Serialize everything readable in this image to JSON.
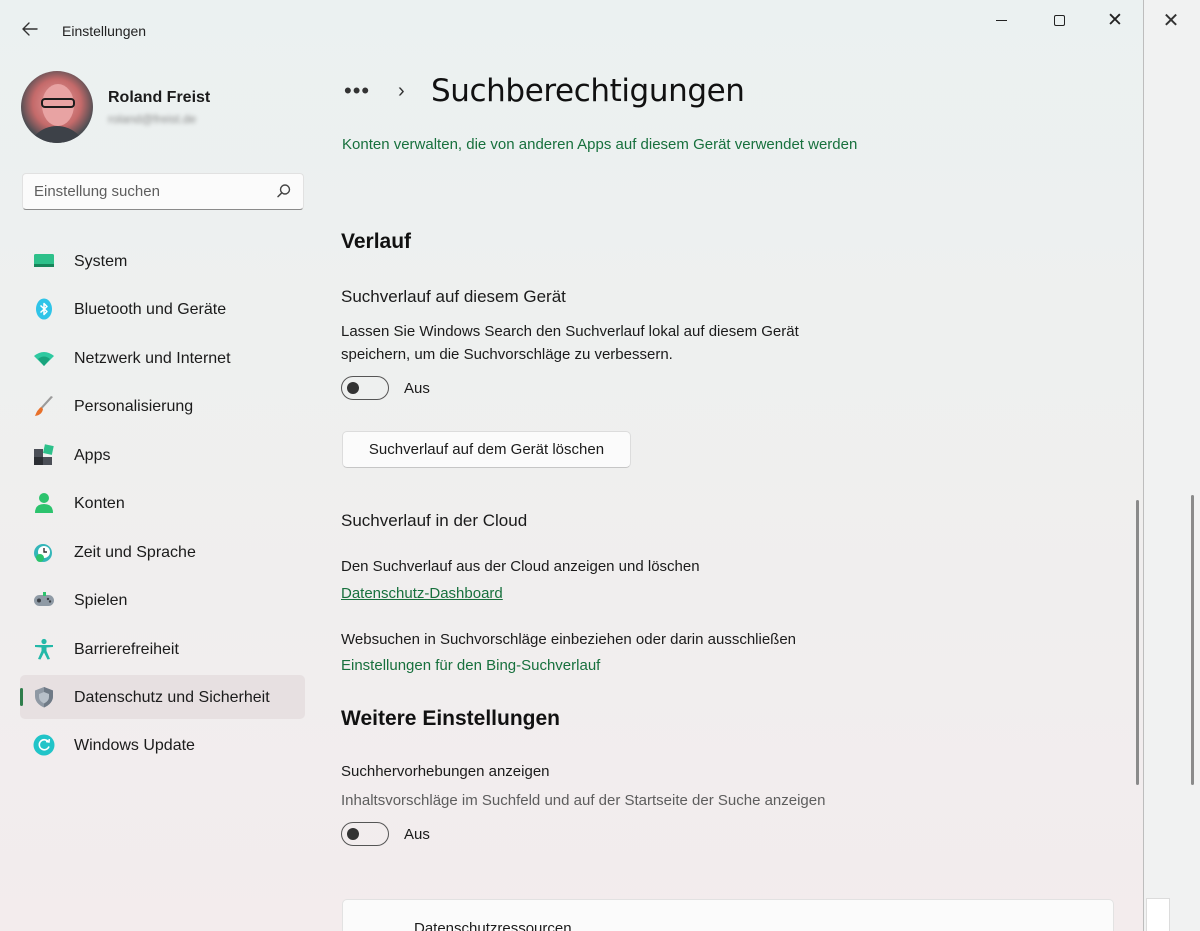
{
  "app": {
    "title": "Einstellungen"
  },
  "window_controls": {
    "minimize": "minimize-icon",
    "maximize": "maximize-icon",
    "close": "close-icon"
  },
  "profile": {
    "name": "Roland Freist",
    "email": "roland@freist.de"
  },
  "search": {
    "placeholder": "Einstellung suchen",
    "icon": "search-icon"
  },
  "sidebar": {
    "items": [
      {
        "label": "System",
        "icon": "system-icon"
      },
      {
        "label": "Bluetooth und Geräte",
        "icon": "bluetooth-icon"
      },
      {
        "label": "Netzwerk und Internet",
        "icon": "wifi-icon"
      },
      {
        "label": "Personalisierung",
        "icon": "brush-icon"
      },
      {
        "label": "Apps",
        "icon": "apps-icon"
      },
      {
        "label": "Konten",
        "icon": "person-icon"
      },
      {
        "label": "Zeit und Sprache",
        "icon": "clock-globe-icon"
      },
      {
        "label": "Spielen",
        "icon": "gamepad-icon"
      },
      {
        "label": "Barrierefreiheit",
        "icon": "accessibility-icon"
      },
      {
        "label": "Datenschutz und Sicherheit",
        "icon": "shield-icon",
        "active": true
      },
      {
        "label": "Windows Update",
        "icon": "update-icon"
      }
    ]
  },
  "breadcrumb": {
    "overflow": "•••",
    "separator": "›"
  },
  "page": {
    "title": "Suchberechtigungen",
    "manage_accounts_link": "Konten verwalten, die von anderen Apps auf diesem Gerät verwendet werden",
    "history": {
      "heading": "Verlauf",
      "device_history_title": "Suchverlauf auf diesem Gerät",
      "device_history_desc": "Lassen Sie Windows Search den Suchverlauf lokal auf diesem Gerät speichern, um die Suchvorschläge zu verbessern.",
      "device_history_toggle_state": "Aus",
      "clear_button": "Suchverlauf auf dem Gerät löschen",
      "cloud_title": "Suchverlauf in der Cloud",
      "cloud_desc": "Den Suchverlauf aus der Cloud anzeigen und löschen",
      "privacy_dashboard_link": "Datenschutz-Dashboard",
      "web_desc": "Websuchen in Suchvorschläge einbeziehen oder darin ausschließen",
      "bing_link": "Einstellungen für den Bing-Suchverlauf"
    },
    "more": {
      "heading": "Weitere Einstellungen",
      "highlights_title": "Suchhervorhebungen anzeigen",
      "highlights_desc": "Inhaltsvorschläge im Suchfeld und auf der Startseite der Suche anzeigen",
      "highlights_toggle_state": "Aus",
      "resources_label": "Datenschutzressourcen"
    }
  },
  "colors": {
    "accent": "#17703d",
    "active_indicator": "#2f7d4b"
  }
}
